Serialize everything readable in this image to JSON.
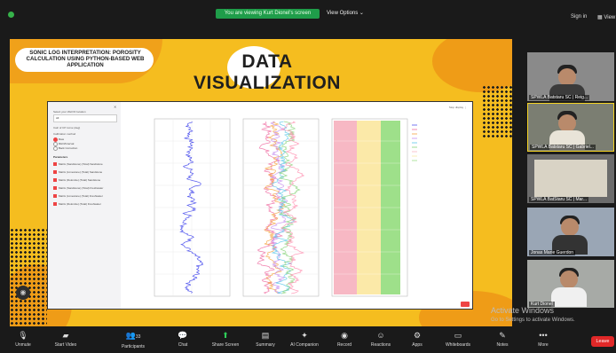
{
  "topbar": {
    "viewing_label": "You are viewing Kurt Dionel's screen",
    "view_options": "View Options",
    "sign_in": "Sign in",
    "view": "View"
  },
  "slide": {
    "subtitle": "SONIC LOG INTERPRETATION: POROSITY CALCULATION USING PYTHON-BASED WEB APPLICATION",
    "title_line1": "DATA",
    "title_line2": "VISUALIZATION"
  },
  "app": {
    "sidebar_select_label": "Select your Well ID location",
    "sidebar_select_value": "All",
    "sidebar_range": "Calc of CP curve (deg)",
    "sidebar_group": "Calibration method",
    "radio_options": [
      "Raw",
      "RHO/Interval",
      "Back Correction"
    ],
    "parameters_label": "Parameters",
    "parameters": [
      "Matrix (Sandstone) (Total) Sandstone",
      "Matrix (Limestone) (Total) Sandstone",
      "Matrix (Dolomite) (Total) Sandstone",
      "Matrix (Sandstone) (Total) Freshwater",
      "Matrix (Limestone) (Total) Freshwater",
      "Matrix (Dolomite) (Total) Freshwater"
    ],
    "toolbar": "Stop display"
  },
  "gallery": [
    {
      "name": "SPWLA Batstaru SC | Reig..."
    },
    {
      "name": "SPWLA Batstaru SC | Gabriel..."
    },
    {
      "name": "SPWLA BatStaru SC | Mar..."
    },
    {
      "name": "Jonas Marie Guerdon"
    },
    {
      "name": "Kurt Dionel"
    }
  ],
  "watermark": {
    "line1": "Activate Windows",
    "line2": "Go to Settings to activate Windows."
  },
  "bottombar": {
    "items": [
      "Unmute",
      "Start Video",
      "Participants",
      "Chat",
      "Share Screen",
      "Summary",
      "AI Companion",
      "Record",
      "Reactions",
      "Apps",
      "Whiteboards",
      "Notes",
      "More"
    ],
    "participants_count": "33",
    "leave": "Leave"
  },
  "colors": {
    "slide_bg": "#f5bd1f",
    "share_green": "#1f9d4a",
    "leave_red": "#e02828"
  }
}
